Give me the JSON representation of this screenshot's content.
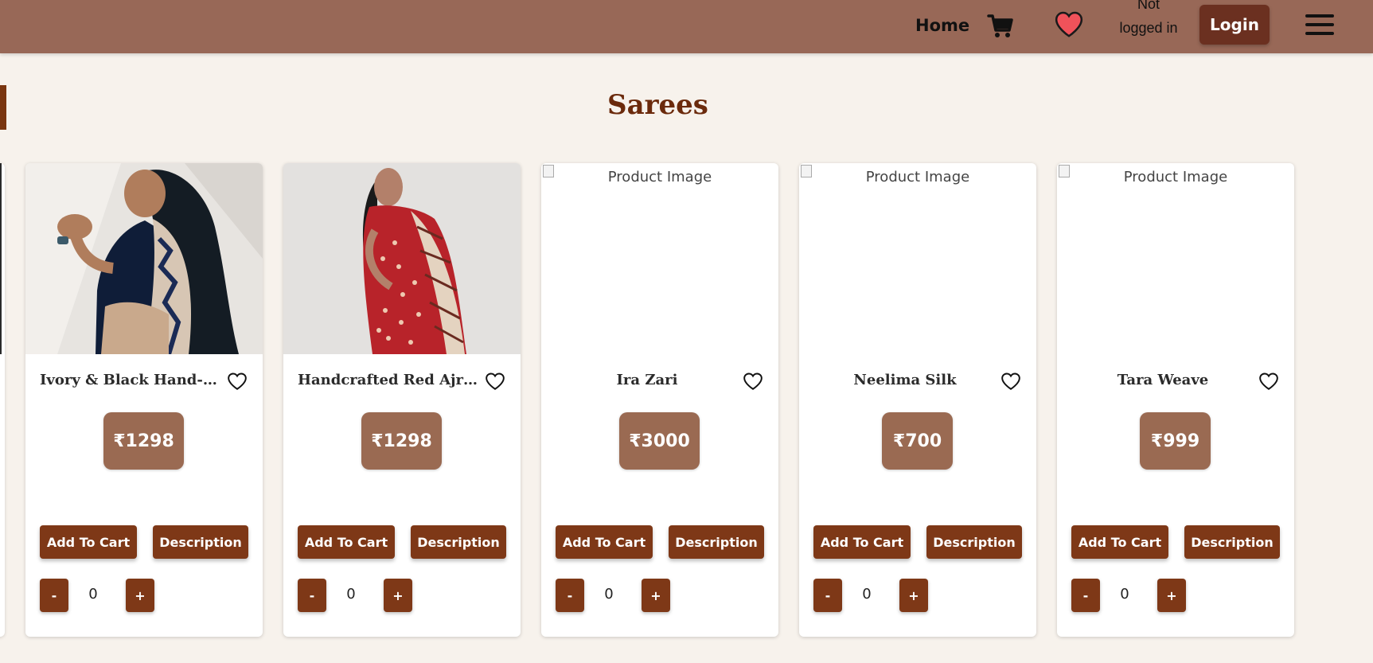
{
  "nav": {
    "home_label": "Home",
    "status_text": "Not logged in",
    "login_label": "Login",
    "heart_color": "#f0525a"
  },
  "section": {
    "title": "Sarees"
  },
  "products": [
    {
      "name": "Ivory & Black Hand-Print...",
      "price": "₹1298",
      "image": "photo",
      "image_alt": "",
      "add_to_cart": "Add To Cart",
      "description": "Description",
      "qty_minus": "-",
      "quantity": "0",
      "qty_plus": "+"
    },
    {
      "name": "Handcrafted Red Ajrak C...",
      "price": "₹1298",
      "image": "photo",
      "image_alt": "",
      "add_to_cart": "Add To Cart",
      "description": "Description",
      "qty_minus": "-",
      "quantity": "0",
      "qty_plus": "+"
    },
    {
      "name": "Ira Zari",
      "price": "₹3000",
      "image": "broken",
      "image_alt": "Product Image",
      "add_to_cart": "Add To Cart",
      "description": "Description",
      "qty_minus": "-",
      "quantity": "0",
      "qty_plus": "+"
    },
    {
      "name": "Neelima Silk",
      "price": "₹700",
      "image": "broken",
      "image_alt": "Product Image",
      "add_to_cart": "Add To Cart",
      "description": "Description",
      "qty_minus": "-",
      "quantity": "0",
      "qty_plus": "+"
    },
    {
      "name": "Tara Weave",
      "price": "₹999",
      "image": "broken",
      "image_alt": "Product Image",
      "add_to_cart": "Add To Cart",
      "description": "Description",
      "qty_minus": "-",
      "quantity": "0",
      "qty_plus": "+"
    }
  ],
  "colors": {
    "navbar": "#986857",
    "accent": "#7e3817",
    "price_badge": "#9a6a52",
    "title": "#6b2a0c",
    "background": "#f7f2ec"
  }
}
